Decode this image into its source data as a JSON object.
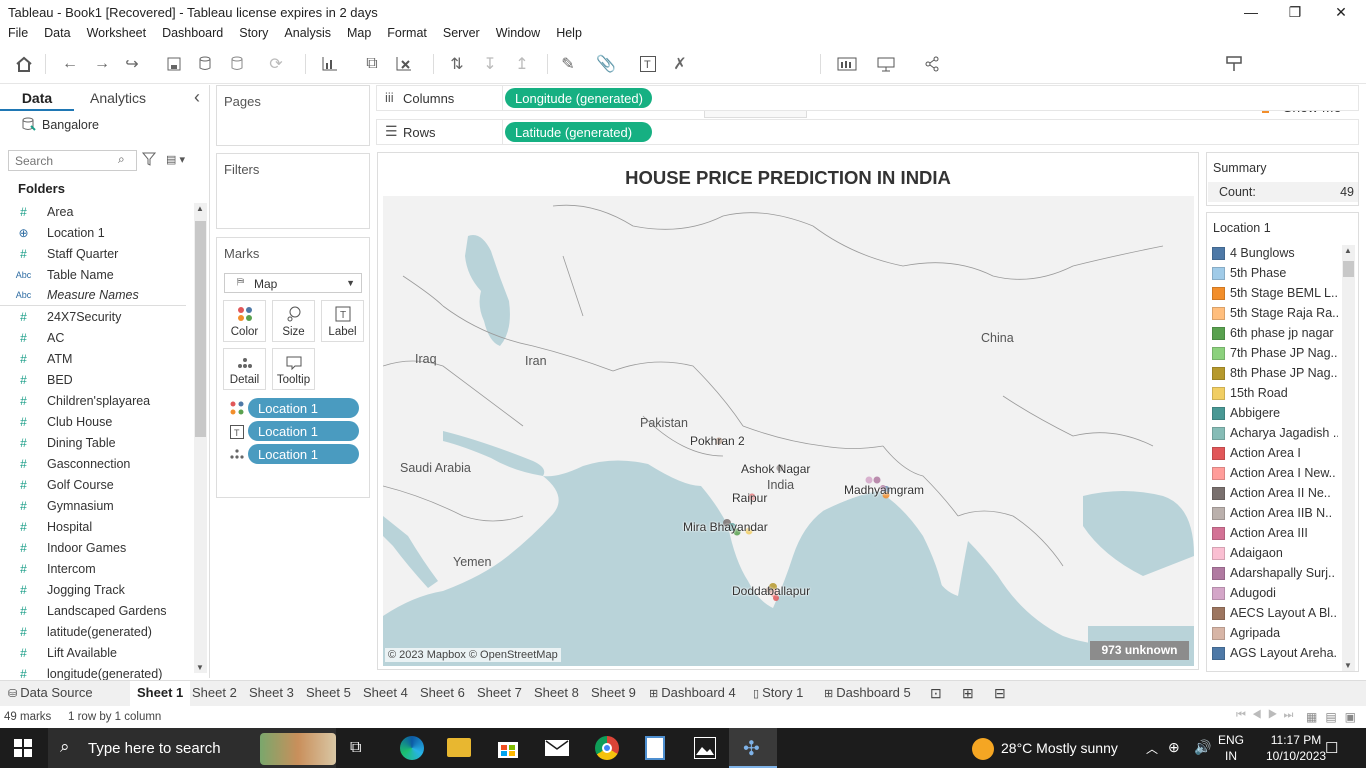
{
  "window": {
    "title": "Tableau - Book1 [Recovered] - Tableau license expires in 2 days",
    "min": "—",
    "restore": "❐",
    "close": "✕"
  },
  "menu": [
    "File",
    "Data",
    "Worksheet",
    "Dashboard",
    "Story",
    "Analysis",
    "Map",
    "Format",
    "Server",
    "Window",
    "Help"
  ],
  "toolbar": {
    "show_me": "Show Me"
  },
  "left": {
    "tab_data": "Data",
    "tab_analytics": "Analytics",
    "collapse": "‹",
    "datasource": "Bangalore",
    "search_placeholder": "Search",
    "folders": "Folders",
    "fields": [
      {
        "icon": "#",
        "label": "Area",
        "kind": "g"
      },
      {
        "icon": "⊕",
        "label": "Location 1",
        "kind": "g"
      },
      {
        "icon": "#",
        "label": "Staff Quarter",
        "kind": "g"
      },
      {
        "icon": "Abc",
        "label": "Table Name",
        "kind": "b"
      },
      {
        "icon": "Abc",
        "label": "Measure Names",
        "kind": "b"
      },
      {
        "icon": "#",
        "label": "24X7Security",
        "kind": "g"
      },
      {
        "icon": "#",
        "label": "AC",
        "kind": "g"
      },
      {
        "icon": "#",
        "label": "ATM",
        "kind": "g"
      },
      {
        "icon": "#",
        "label": "BED",
        "kind": "g"
      },
      {
        "icon": "#",
        "label": "Children'splayarea",
        "kind": "g"
      },
      {
        "icon": "#",
        "label": "Club House",
        "kind": "g"
      },
      {
        "icon": "#",
        "label": "Dining Table",
        "kind": "g"
      },
      {
        "icon": "#",
        "label": "Gasconnection",
        "kind": "g"
      },
      {
        "icon": "#",
        "label": "Golf Course",
        "kind": "g"
      },
      {
        "icon": "#",
        "label": "Gymnasium",
        "kind": "g"
      },
      {
        "icon": "#",
        "label": "Hospital",
        "kind": "g"
      },
      {
        "icon": "#",
        "label": "Indoor Games",
        "kind": "g"
      },
      {
        "icon": "#",
        "label": "Intercom",
        "kind": "g"
      },
      {
        "icon": "#",
        "label": "Jogging Track",
        "kind": "g"
      },
      {
        "icon": "#",
        "label": "Landscaped Gardens",
        "kind": "g"
      },
      {
        "icon": "#",
        "label": "latitude(generated)",
        "kind": "g"
      },
      {
        "icon": "#",
        "label": "Lift Available",
        "kind": "g"
      },
      {
        "icon": "#",
        "label": "longitude(generated)",
        "kind": "g"
      }
    ]
  },
  "pages": "Pages",
  "filters": "Filters",
  "marks": {
    "title": "Marks",
    "type": "Map",
    "buttons": {
      "color": "Color",
      "size": "Size",
      "label": "Label",
      "detail": "Detail",
      "tooltip": "Tooltip"
    },
    "pills": [
      "Location 1",
      "Location 1",
      "Location 1"
    ]
  },
  "shelves": {
    "columns_label": "Columns",
    "columns_pill": "Longitude (generated)",
    "rows_label": "Rows",
    "rows_pill": "Latitude (generated)"
  },
  "view": {
    "title": "HOUSE PRICE PREDICTION IN INDIA",
    "attribution": "© 2023 Mapbox © OpenStreetMap",
    "unknown": "973 unknown",
    "regions": [
      "China",
      "Iraq",
      "Iran",
      "Pakistan",
      "India",
      "Saudi Arabia",
      "Yemen"
    ],
    "cities": [
      "Pokhran 2",
      "Ashok Nagar",
      "Raipur",
      "Madhyamgram",
      "Mira Bhayandar",
      "Doddaballapur"
    ]
  },
  "summary": {
    "title": "Summary",
    "count_label": "Count:",
    "count_value": "49"
  },
  "legend": {
    "title": "Location 1",
    "items": [
      {
        "label": "4 Bunglows",
        "color": "#4e79a7"
      },
      {
        "label": "5th Phase",
        "color": "#a0cbe8"
      },
      {
        "label": "5th Stage BEML L..",
        "color": "#f28e2b"
      },
      {
        "label": "5th Stage Raja Ra..",
        "color": "#ffbe7d"
      },
      {
        "label": "6th phase jp nagar",
        "color": "#59a14f"
      },
      {
        "label": "7th Phase JP Nag..",
        "color": "#8cd17d"
      },
      {
        "label": "8th Phase JP Nag..",
        "color": "#b6992d"
      },
      {
        "label": "15th Road",
        "color": "#f1ce63"
      },
      {
        "label": "Abbigere",
        "color": "#499894"
      },
      {
        "label": "Acharya Jagadish ..",
        "color": "#86bcb6"
      },
      {
        "label": "Action Area I",
        "color": "#e15759"
      },
      {
        "label": "Action Area I New..",
        "color": "#ff9d9a"
      },
      {
        "label": "Action Area II Ne..",
        "color": "#79706e"
      },
      {
        "label": "Action Area IIB N..",
        "color": "#bab0ac"
      },
      {
        "label": "Action Area III",
        "color": "#d37295"
      },
      {
        "label": "Adaigaon",
        "color": "#fabfd2"
      },
      {
        "label": "Adarshapally Surj..",
        "color": "#b07aa1"
      },
      {
        "label": "Adugodi",
        "color": "#d4a6c8"
      },
      {
        "label": "AECS Layout A Bl..",
        "color": "#9d7660"
      },
      {
        "label": "Agripada",
        "color": "#d7b5a6"
      },
      {
        "label": "AGS Layout Areha..",
        "color": "#4e79a7"
      }
    ]
  },
  "sheets": [
    "Data Source",
    "Sheet 1",
    "Sheet 2",
    "Sheet 3",
    "Sheet 5",
    "Sheet 4",
    "Sheet 6",
    "Sheet 7",
    "Sheet 8",
    "Sheet 9",
    "Dashboard 4",
    "Story 1",
    "Dashboard 5"
  ],
  "status": {
    "marks": "49 marks",
    "rows": "1 row by 1 column"
  },
  "taskbar": {
    "search": "Type here to search",
    "weather": "28°C  Mostly sunny",
    "lang1": "ENG",
    "lang2": "IN",
    "time": "11:17 PM",
    "date": "10/10/2023"
  }
}
